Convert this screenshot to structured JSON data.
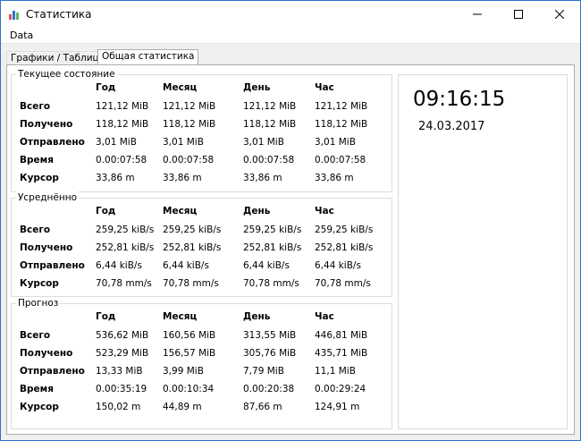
{
  "window": {
    "title": "Статистика"
  },
  "menu": {
    "items": [
      "Data"
    ]
  },
  "tabs": [
    "Графики / Таблицы",
    "Общая статистика"
  ],
  "columns": [
    "Год",
    "Месяц",
    "День",
    "Час"
  ],
  "groups": [
    {
      "title": "Текущее состояние",
      "rows": [
        {
          "label": "Всего",
          "values": [
            "121,12 MiB",
            "121,12 MiB",
            "121,12 MiB",
            "121,12 MiB"
          ]
        },
        {
          "label": "Получено",
          "values": [
            "118,12 MiB",
            "118,12 MiB",
            "118,12 MiB",
            "118,12 MiB"
          ]
        },
        {
          "label": "Отправлено",
          "values": [
            "3,01 MiB",
            "3,01 MiB",
            "3,01 MiB",
            "3,01 MiB"
          ]
        },
        {
          "label": "Время",
          "values": [
            "0.00:07:58",
            "0.00:07:58",
            "0.00:07:58",
            "0.00:07:58"
          ]
        },
        {
          "label": "Курсор",
          "values": [
            "33,86 m",
            "33,86 m",
            "33,86 m",
            "33,86 m"
          ]
        }
      ]
    },
    {
      "title": "Усреднённо",
      "rows": [
        {
          "label": "Всего",
          "values": [
            "259,25 kiB/s",
            "259,25 kiB/s",
            "259,25 kiB/s",
            "259,25 kiB/s"
          ]
        },
        {
          "label": "Получено",
          "values": [
            "252,81 kiB/s",
            "252,81 kiB/s",
            "252,81 kiB/s",
            "252,81 kiB/s"
          ]
        },
        {
          "label": "Отправлено",
          "values": [
            "6,44 kiB/s",
            "6,44 kiB/s",
            "6,44 kiB/s",
            "6,44 kiB/s"
          ]
        },
        {
          "label": "Курсор",
          "values": [
            "70,78 mm/s",
            "70,78 mm/s",
            "70,78 mm/s",
            "70,78 mm/s"
          ]
        }
      ]
    },
    {
      "title": "Прогноз",
      "rows": [
        {
          "label": "Всего",
          "values": [
            "536,62 MiB",
            "160,56 MiB",
            "313,55 MiB",
            "446,81 MiB"
          ]
        },
        {
          "label": "Получено",
          "values": [
            "523,29 MiB",
            "156,57 MiB",
            "305,76 MiB",
            "435,71 MiB"
          ]
        },
        {
          "label": "Отправлено",
          "values": [
            "13,33 MiB",
            "3,99 MiB",
            "7,79 MiB",
            "11,1 MiB"
          ]
        },
        {
          "label": "Время",
          "values": [
            "0.00:35:19",
            "0.00:10:34",
            "0.00:20:38",
            "0.00:29:24"
          ]
        },
        {
          "label": "Курсор",
          "values": [
            "150,02 m",
            "44,89 m",
            "87,66 m",
            "124,91 m"
          ]
        }
      ]
    }
  ],
  "clock": {
    "time": "09:16:15",
    "date": "24.03.2017"
  }
}
